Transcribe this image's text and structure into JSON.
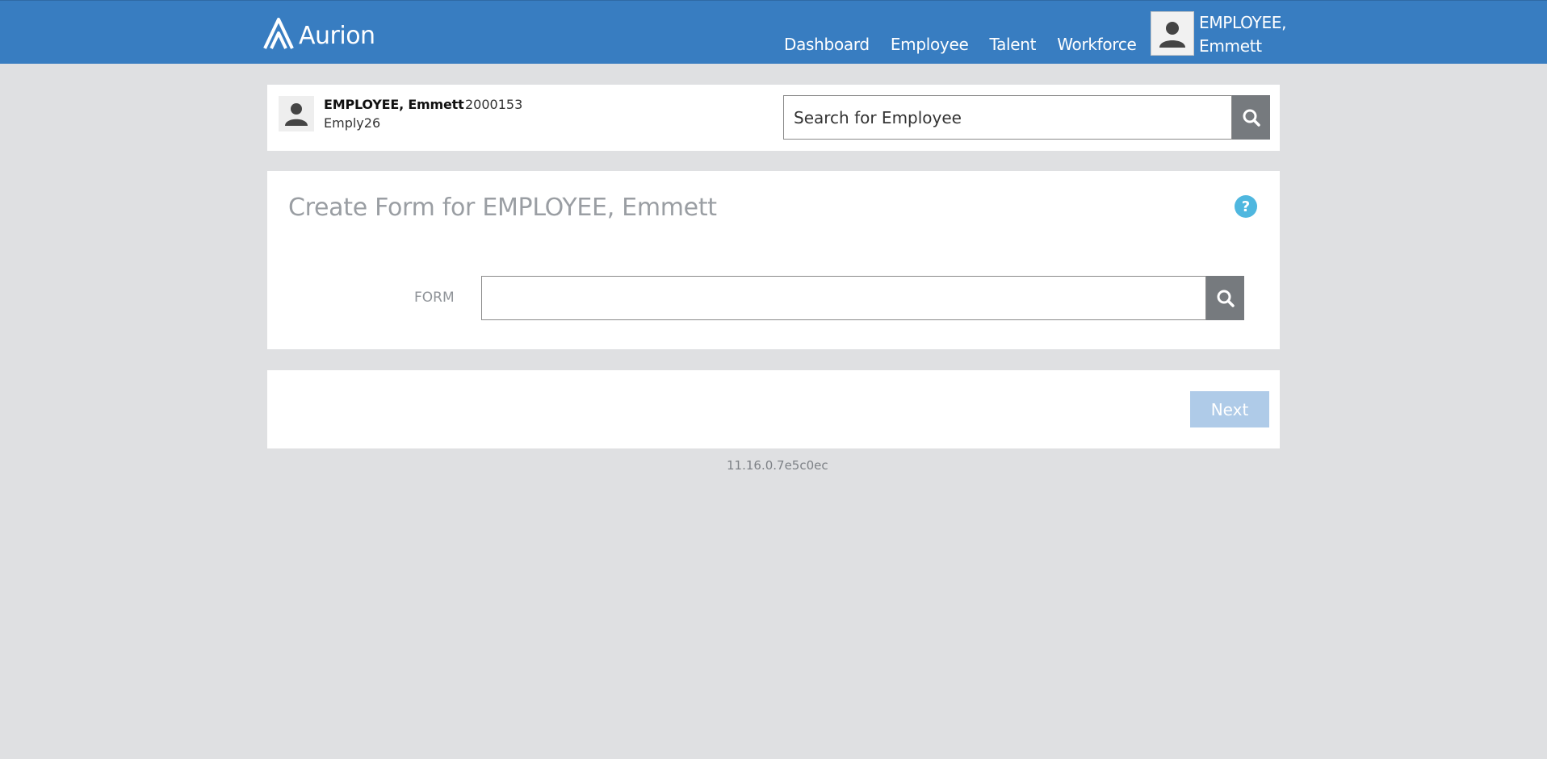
{
  "header": {
    "logo_text": "Aurion",
    "nav": [
      "Dashboard",
      "Employee",
      "Talent",
      "Workforce"
    ],
    "user_line1": "EMPLOYEE,",
    "user_line2": "Emmett"
  },
  "employee": {
    "name": "EMPLOYEE, Emmett",
    "number": "2000153",
    "code": "Emply26",
    "search_placeholder": "Search for Employee"
  },
  "form": {
    "title": "Create Form for EMPLOYEE, Emmett",
    "help": "?",
    "label": "FORM",
    "value": ""
  },
  "actions": {
    "next_label": "Next"
  },
  "footer": {
    "version": "11.16.0.7e5c0ec"
  },
  "colors": {
    "header_bg": "#387dc1",
    "page_bg": "#dfe0e2",
    "button_gray": "#767a7e",
    "next_disabled": "#afcbe8",
    "help_blue": "#4fb7df"
  }
}
